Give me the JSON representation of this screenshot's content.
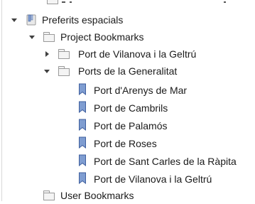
{
  "tree": {
    "root": {
      "label": "Preferits espacials",
      "icon": "bookmarks-book-icon",
      "expanded": true
    },
    "project": {
      "label": "Project Bookmarks",
      "icon": "folder-icon",
      "expanded": true
    },
    "group_vilanova": {
      "label": "Port de Vilanova i la Geltrú",
      "icon": "folder-icon",
      "expanded": false
    },
    "group_generalitat": {
      "label": "Ports de la Generalitat",
      "icon": "folder-icon",
      "expanded": true,
      "items": [
        {
          "label": "Port d'Arenys de Mar",
          "icon": "bookmark-icon"
        },
        {
          "label": "Port de Cambrils",
          "icon": "bookmark-icon"
        },
        {
          "label": "Port de Palamós",
          "icon": "bookmark-icon"
        },
        {
          "label": "Port de Roses",
          "icon": "bookmark-icon"
        },
        {
          "label": "Port de Sant Carles de la Ràpita",
          "icon": "bookmark-icon"
        },
        {
          "label": "Port de Vilanova i la Geltrú",
          "icon": "bookmark-icon"
        }
      ]
    },
    "user": {
      "label": "User Bookmarks",
      "icon": "folder-icon",
      "expanded": false
    }
  },
  "colors": {
    "bookmark_fill": "#7f9dd1",
    "bookmark_stroke": "#3f5f9e",
    "folder_stroke": "#9a9a9a",
    "folder_fill": "#f4f4f4",
    "text": "#1a1a1a",
    "chevron": "#404040"
  }
}
